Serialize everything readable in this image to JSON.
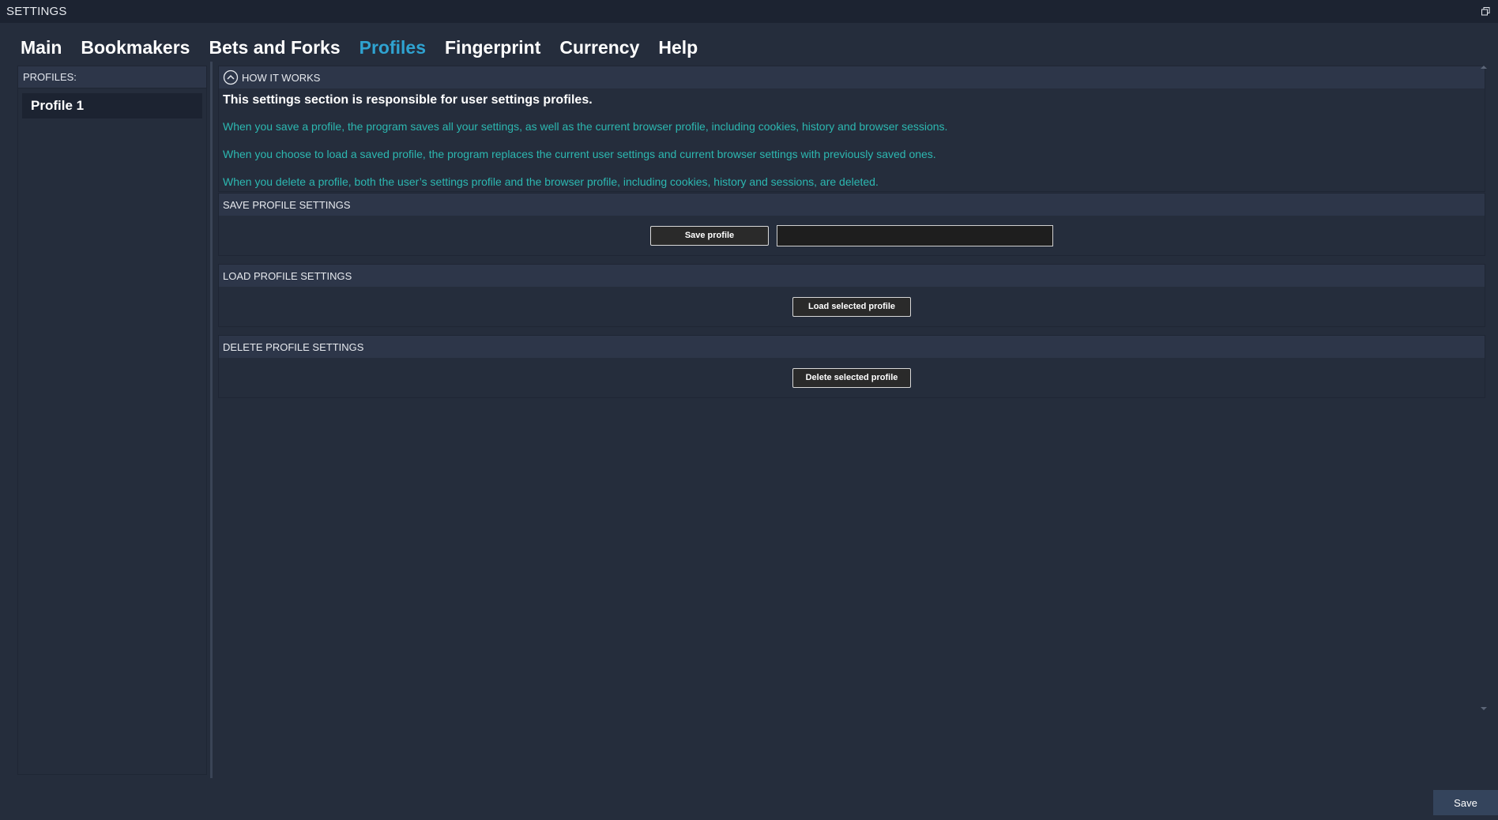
{
  "window": {
    "title": "SETTINGS"
  },
  "tabs": [
    {
      "label": "Main"
    },
    {
      "label": "Bookmakers"
    },
    {
      "label": "Bets and Forks"
    },
    {
      "label": "Profiles",
      "active": true
    },
    {
      "label": "Fingerprint"
    },
    {
      "label": "Currency"
    },
    {
      "label": "Help"
    }
  ],
  "sidebar": {
    "header": "PROFILES:",
    "profiles": [
      {
        "label": "Profile 1"
      }
    ]
  },
  "how_it_works": {
    "header": "HOW IT WORKS",
    "title": "This settings section is responsible for user settings profiles.",
    "lines": [
      "When you save a profile, the program saves all your settings, as well as the current browser profile, including cookies, history and browser sessions.",
      "When you choose to load a saved profile, the program replaces the current user settings and current browser settings with previously saved ones.",
      "When you delete a profile, both the user’s settings profile and the browser profile, including cookies, history and sessions, are deleted."
    ]
  },
  "save_section": {
    "header": "SAVE PROFILE SETTINGS",
    "button": "Save profile",
    "input_value": ""
  },
  "load_section": {
    "header": "LOAD PROFILE SETTINGS",
    "button": "Load selected profile"
  },
  "delete_section": {
    "header": "DELETE PROFILE SETTINGS",
    "button": "Delete selected profile"
  },
  "footer": {
    "save_label": "Save"
  },
  "colors": {
    "background": "#252d3c",
    "titlebar": "#1c2331",
    "active_tab": "#2fa3d1",
    "info_text": "#2cb8b1",
    "section_header": "#2d3649"
  },
  "icons": {
    "restore": "restore-window-icon",
    "collapse": "chevron-up-circle-icon"
  }
}
